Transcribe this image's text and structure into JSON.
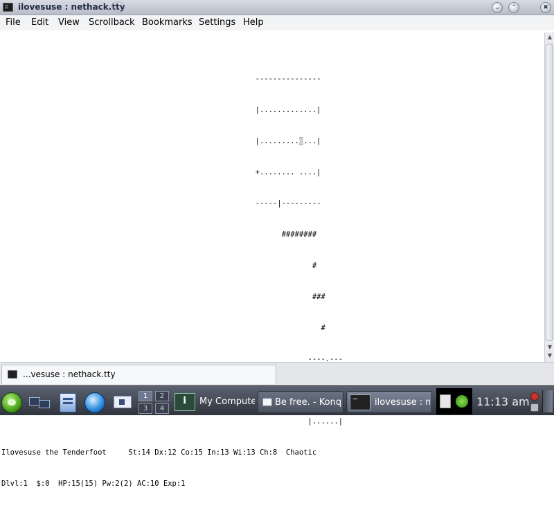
{
  "window": {
    "title": "ilovesuse : nethack.tty",
    "buttons": {
      "minimize": "⌄",
      "maximize": "⌃",
      "close": "✖"
    }
  },
  "menu": [
    "File",
    "Edit",
    "View",
    "Scrollback",
    "Bookmarks",
    "Settings",
    "Help"
  ],
  "terminal": {
    "lines": [
      "                                                          ---------------",
      "                                                          |.............|",
      "                                                          |.........",
      "                                                          +........ ....|",
      "                                                          -----|---------",
      "                                                                ########",
      "                                                                       #",
      "                                                                       ###",
      "                                                                         #",
      "                                                                      ----.---",
      "                                                                      |......|",
      "                                                                      |......|",
      "Ilovesuse the Tenderfoot     St:14 Dx:12 Co:15 In:13 Wi:13 Ch:8  Chaotic",
      "Dlvl:1  $:0  HP:15(15) Pw:2(2) AC:10 Exp:1"
    ],
    "cursor_line_prefix": "                                                          |.........",
    "cursor_char": "@",
    "cursor_line_suffix": "...|"
  },
  "scrollbar": {
    "up": "▲",
    "down": "▼"
  },
  "session_tab": {
    "label": "...vesuse : nethack.tty"
  },
  "panel": {
    "pager": [
      "1",
      "2",
      "3",
      "4"
    ],
    "tasks": {
      "mycomputer": "My Computer",
      "konqueror": "Be free. - Konqueror",
      "terminal": "ilovesuse : nethack.tty"
    },
    "clock": "11:13 am"
  }
}
